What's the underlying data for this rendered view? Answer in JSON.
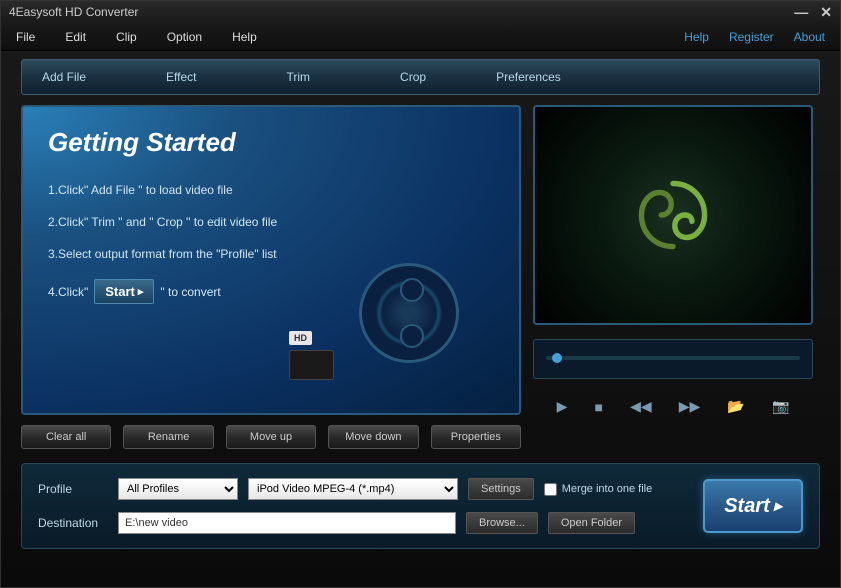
{
  "window": {
    "title": "4Easysoft HD Converter"
  },
  "menubar": {
    "left": [
      "File",
      "Edit",
      "Clip",
      "Option",
      "Help"
    ],
    "right": [
      "Help",
      "Register",
      "About"
    ]
  },
  "toolbar": [
    "Add File",
    "Effect",
    "Trim",
    "Crop",
    "Preferences"
  ],
  "getting_started": {
    "title": "Getting Started",
    "step1": "1.Click\" Add File \" to load video file",
    "step2": "2.Click\" Trim \" and \" Crop \" to edit video file",
    "step3": "3.Select output format from the \"Profile\" list",
    "step4_prefix": "4.Click\"",
    "step4_btn": "Start",
    "step4_suffix": "\" to convert",
    "hd_label": "HD"
  },
  "file_buttons": [
    "Clear all",
    "Rename",
    "Move up",
    "Move down",
    "Properties"
  ],
  "settings": {
    "profile_label": "Profile",
    "profile_filter": "All Profiles",
    "profile_format": "iPod Video MPEG-4 (*.mp4)",
    "settings_btn": "Settings",
    "merge_label": "Merge into one file",
    "destination_label": "Destination",
    "destination_value": "E:\\new video",
    "browse_btn": "Browse...",
    "open_folder_btn": "Open Folder"
  },
  "start_button": "Start"
}
